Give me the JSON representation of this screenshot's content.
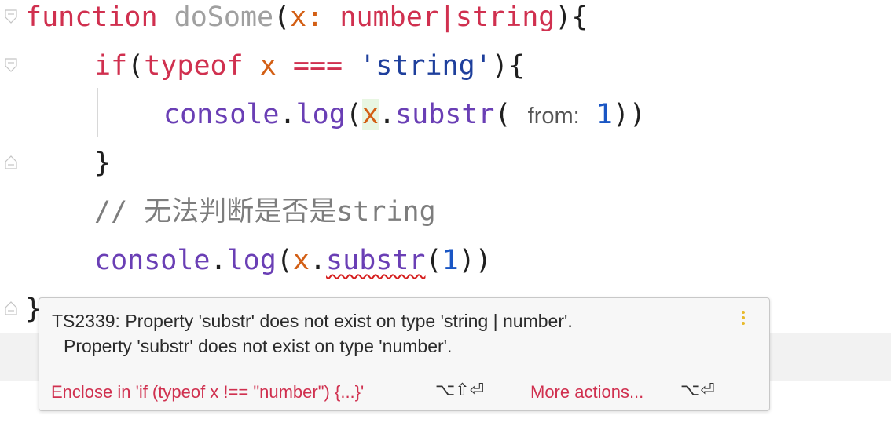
{
  "code": {
    "line1": {
      "kw": "function",
      "name": "doSome",
      "open": "(",
      "param": "x",
      "colon": ": ",
      "types": "number|string",
      "close": "){"
    },
    "line2": {
      "kw1": "if",
      "open": "(",
      "kw2": "typeof",
      "sp1": " ",
      "param": "x",
      "sp2": " ",
      "op": "===",
      "sp3": " ",
      "str": "'string'",
      "close": "){"
    },
    "line3": {
      "obj": "console",
      "dot1": ".",
      "method": "log",
      "open": "(",
      "param": "x",
      "dot2": ".",
      "sub": "substr",
      "open2": "( ",
      "hint": "from:",
      "sp": " ",
      "num": "1",
      "close": "))"
    },
    "line4": {
      "brace": "}"
    },
    "line5": {
      "comment": "// 无法判断是否是string"
    },
    "line6": {
      "obj": "console",
      "dot1": ".",
      "method": "log",
      "open": "(",
      "param": "x",
      "dot2": ".",
      "sub": "substr",
      "open2": "(",
      "num": "1",
      "close": "))"
    },
    "line7": {
      "brace": "}"
    }
  },
  "popup": {
    "message_line1": "TS2339: Property 'substr' does not exist on type 'string | number'.",
    "message_line2": "Property 'substr' does not exist on type 'number'.",
    "action1_label": "Enclose in 'if (typeof x !== \"number\") {...}'",
    "action1_shortcut": "⌥⇧⏎",
    "action2_label": "More actions...",
    "action2_shortcut": "⌥⏎"
  },
  "colors": {
    "keyword": "#d0304f",
    "parameter": "#d35f15",
    "string": "#1e3f9c",
    "number": "#1a56c4",
    "error_underline": "#d61f1f",
    "more_icon": "#e8b92a"
  }
}
